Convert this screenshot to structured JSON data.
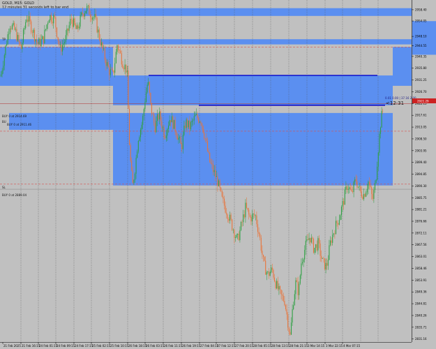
{
  "header": {
    "symbol_line": "GOLD, M15: GOLD",
    "timer_line": "12 minutes 31 seconds left to bar end"
  },
  "colors": {
    "background": "#c0c0c0",
    "zone": "#5b8ff0",
    "bull_candle": "#2ea043",
    "bear_candle": "#e8743b",
    "trend_line": "#0000cc",
    "level_red": "#d9534f",
    "current_price_bg": "#cc2222"
  },
  "annotations": {
    "tp_label": "TP",
    "sl_label": "SL",
    "buy1": "BUY 0 at 2914.69",
    "buy2": "BUY 0 at 2911.46",
    "buy3": "BUY 0 at 2889.04",
    "side_tag": "BU",
    "position_text": "0.01 0.00 | 37.16 2.00",
    "countdown": "<12:31"
  },
  "chart_data": {
    "type": "candlestick",
    "symbol": "GOLD",
    "timeframe": "M15",
    "current_price": "2921.29",
    "y_axis": {
      "min": 2830.0,
      "max": 2960.0,
      "ticks": [
        "2958.40",
        "2954.05",
        "2948.10",
        "2944.55",
        "2940.35",
        "2935.80",
        "2931.25",
        "2926.70",
        "2922.15",
        "2917.61",
        "2913.05",
        "2908.50",
        "2903.95",
        "2899.40",
        "2894.85",
        "2890.30",
        "2885.75",
        "2881.21",
        "2876.66",
        "2872.11",
        "2867.56",
        "2863.01",
        "2858.46",
        "2853.91",
        "2849.36",
        "2844.81",
        "2840.26",
        "2835.71",
        "2831.16"
      ]
    },
    "x_axis": {
      "ticks": [
        "21 Feb 2025",
        "21 Feb 16:15",
        "24 Feb 01:15",
        "24 Feb 09:15",
        "24 Feb 17:15",
        "25 Feb 02:15",
        "25 Feb 10:15",
        "26 Feb 18:15",
        "26 Feb 03:15",
        "26 Feb 11:15",
        "26 Feb 19:15",
        "27 Feb 04:15",
        "27 Feb 12:15",
        "27 Feb 20:15",
        "28 Feb 05:15",
        "28 Feb 13:15",
        "28 Feb 21:15",
        "3 Mar 14:15",
        "3 Mar 22:15",
        "4 Mar 07:15"
      ]
    },
    "levels": {
      "tp": 2944.0,
      "buy1": 2914.69,
      "buy2": 2911.46,
      "sl": 2891.0,
      "buy3": 2889.04,
      "trend_upper": 2933.0,
      "trend_lower": 2921.5
    },
    "zones": [
      {
        "from": 2929.0,
        "to": 2954.0
      },
      {
        "from": 2890.5,
        "to": 2933.0
      }
    ],
    "price_path": [
      [
        0,
        2931
      ],
      [
        8,
        2944
      ],
      [
        14,
        2953
      ],
      [
        22,
        2950
      ],
      [
        30,
        2943
      ],
      [
        38,
        2956
      ],
      [
        46,
        2951
      ],
      [
        54,
        2945
      ],
      [
        62,
        2947
      ],
      [
        70,
        2956
      ],
      [
        78,
        2955
      ],
      [
        86,
        2943
      ],
      [
        94,
        2947
      ],
      [
        102,
        2955
      ],
      [
        110,
        2950
      ],
      [
        118,
        2957
      ],
      [
        124,
        2959
      ],
      [
        130,
        2957
      ],
      [
        136,
        2955
      ],
      [
        144,
        2946
      ],
      [
        150,
        2940
      ],
      [
        156,
        2935
      ],
      [
        162,
        2933
      ],
      [
        168,
        2945
      ],
      [
        176,
        2938
      ],
      [
        182,
        2935
      ],
      [
        186,
        2903
      ],
      [
        190,
        2890
      ],
      [
        194,
        2898
      ],
      [
        198,
        2909
      ],
      [
        204,
        2915
      ],
      [
        208,
        2924
      ],
      [
        212,
        2931
      ],
      [
        216,
        2921
      ],
      [
        222,
        2913
      ],
      [
        228,
        2918
      ],
      [
        236,
        2910
      ],
      [
        244,
        2917
      ],
      [
        252,
        2912
      ],
      [
        260,
        2905
      ],
      [
        266,
        2915
      ],
      [
        272,
        2913
      ],
      [
        280,
        2917
      ],
      [
        288,
        2916
      ],
      [
        294,
        2909
      ],
      [
        300,
        2900
      ],
      [
        306,
        2896
      ],
      [
        312,
        2892
      ],
      [
        318,
        2885
      ],
      [
        326,
        2880
      ],
      [
        334,
        2874
      ],
      [
        340,
        2869
      ],
      [
        346,
        2875
      ],
      [
        352,
        2882
      ],
      [
        358,
        2878
      ],
      [
        366,
        2879
      ],
      [
        372,
        2871
      ],
      [
        378,
        2860
      ],
      [
        384,
        2856
      ],
      [
        390,
        2858
      ],
      [
        396,
        2852
      ],
      [
        402,
        2848
      ],
      [
        408,
        2846
      ],
      [
        412,
        2839
      ],
      [
        416,
        2832
      ],
      [
        420,
        2845
      ],
      [
        424,
        2853
      ],
      [
        428,
        2849
      ],
      [
        432,
        2861
      ],
      [
        438,
        2867
      ],
      [
        444,
        2871
      ],
      [
        450,
        2866
      ],
      [
        456,
        2868
      ],
      [
        462,
        2861
      ],
      [
        468,
        2859
      ],
      [
        474,
        2869
      ],
      [
        480,
        2874
      ],
      [
        486,
        2878
      ],
      [
        492,
        2884
      ],
      [
        498,
        2891
      ],
      [
        504,
        2887
      ],
      [
        510,
        2893
      ],
      [
        516,
        2888
      ],
      [
        522,
        2887
      ],
      [
        528,
        2892
      ],
      [
        534,
        2885
      ],
      [
        538,
        2891
      ],
      [
        542,
        2904
      ],
      [
        546,
        2916
      ],
      [
        550,
        2921
      ]
    ]
  }
}
